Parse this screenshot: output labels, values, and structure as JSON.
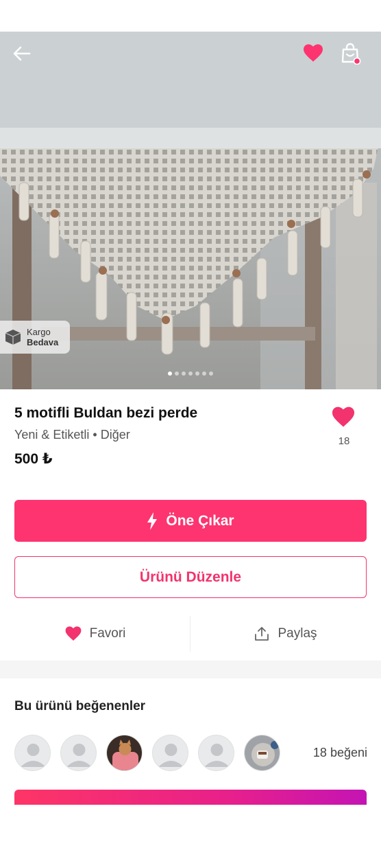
{
  "colors": {
    "accent": "#fd346f",
    "heart": "#f2336d",
    "text": "#111111"
  },
  "header": {
    "back_icon": "arrow-left-icon",
    "favorite_icon": "heart-icon",
    "cart_icon": "shopping-bag-icon"
  },
  "gallery": {
    "badge_line1": "Kargo",
    "badge_line2": "Bedava",
    "image_count": 7,
    "active_index": 0
  },
  "product": {
    "title": "5 motifli Buldan bezi perde",
    "condition": "Yeni & Etiketli • Diğer",
    "price": "500 ₺",
    "like_count": "18"
  },
  "buttons": {
    "promote_label": "Öne Çıkar",
    "edit_label": "Ürünü Düzenle",
    "favorite_label": "Favori",
    "share_label": "Paylaş"
  },
  "likers": {
    "title": "Bu ürünü beğenenler",
    "total": "18 beğeni",
    "avatars": [
      "default",
      "default",
      "cat-photo",
      "default",
      "default",
      "tea-photo"
    ]
  }
}
